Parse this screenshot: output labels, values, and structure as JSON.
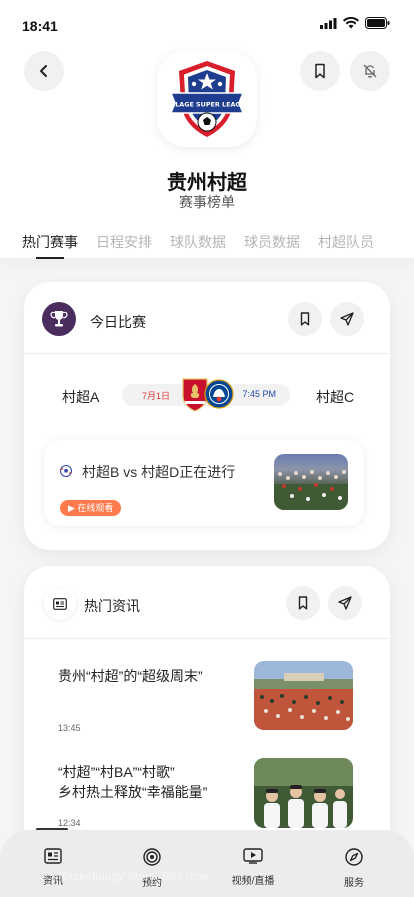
{
  "status": {
    "time": "18:41"
  },
  "header": {
    "title": "贵州村超",
    "subtitle": "赛事榜单",
    "logo_text": "VILLAGE SUPER LEAGUE"
  },
  "tabs": [
    "热门赛事",
    "日程安排",
    "球队数据",
    "球员数据",
    "村超队员"
  ],
  "today": {
    "title": "今日比赛",
    "team_left": "村超A",
    "team_right": "村超C",
    "date": "7月1日",
    "time": "7:45 PM",
    "live_text": "村超B vs 村超D正在进行",
    "live_button": "▶ 在线观看"
  },
  "news": {
    "title": "热门资讯",
    "items": [
      {
        "title": "贵州“村超”的“超级周末”",
        "time": "13:45"
      },
      {
        "title_line1": "“村超”“村BA”“村歌”",
        "title_line2": "乡村热土释放“幸福能量”",
        "time": "12:34"
      }
    ]
  },
  "nav": [
    {
      "label": "资讯",
      "icon": "news-icon"
    },
    {
      "label": "预约",
      "icon": "target-icon"
    },
    {
      "label": "视频/直播",
      "icon": "video-icon"
    },
    {
      "label": "服务",
      "icon": "compass-icon"
    }
  ],
  "watermark": "Racketology Stam. Illini mov..."
}
